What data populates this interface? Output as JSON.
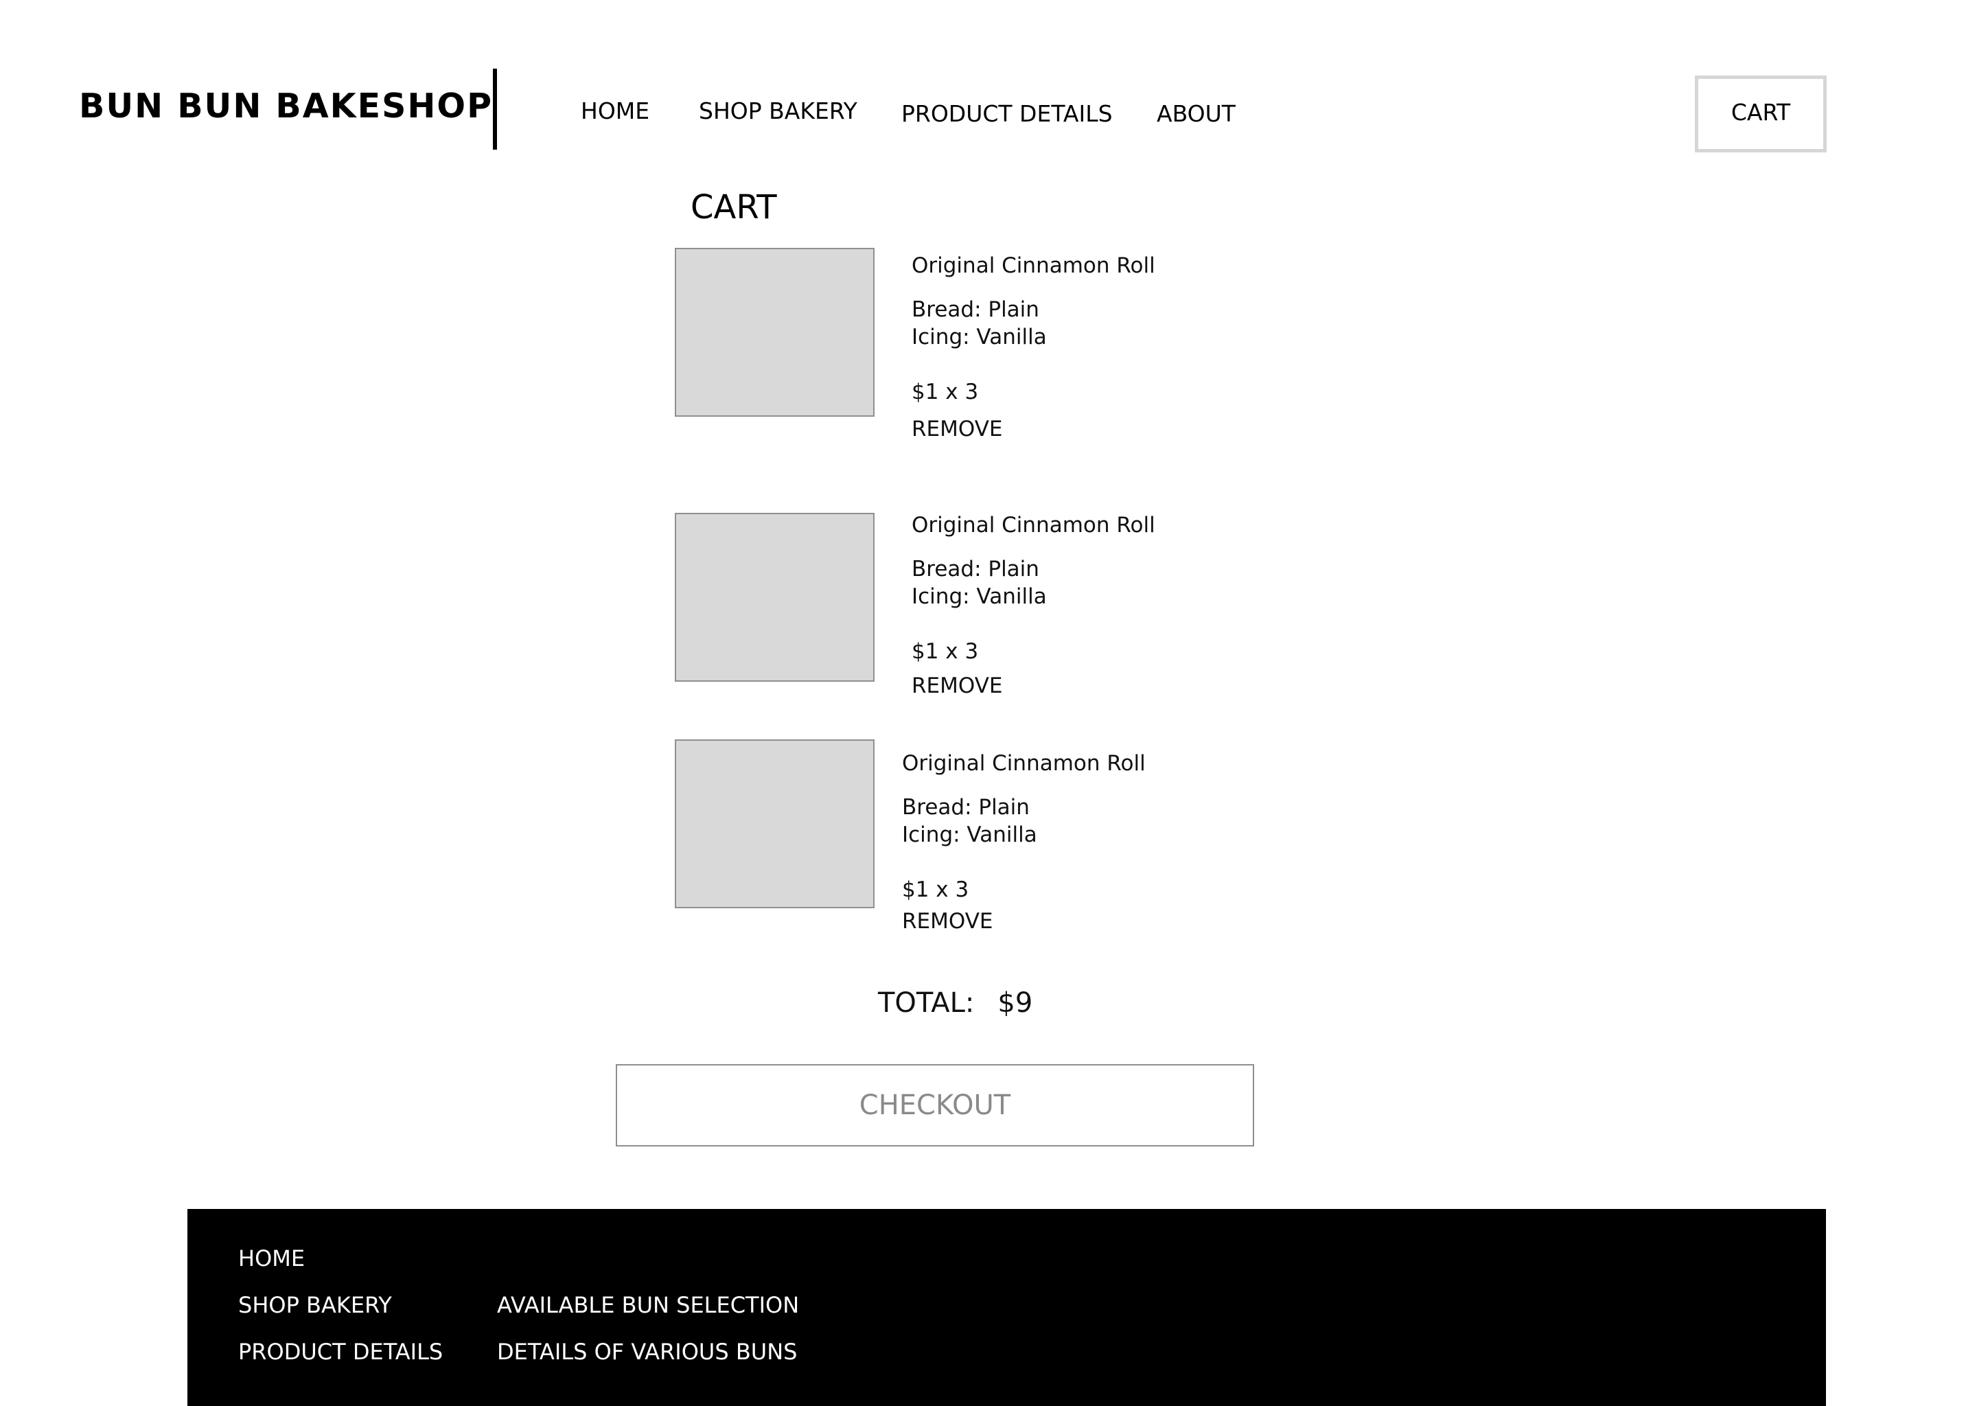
{
  "header": {
    "brand": "BUN BUN BAKESHOP",
    "nav": {
      "home": "HOME",
      "shop_bakery": "SHOP BAKERY",
      "product_details": "PRODUCT DETAILS",
      "about": "ABOUT"
    },
    "cart_button": "CART"
  },
  "cart": {
    "title": "CART",
    "items": [
      {
        "name": "Original Cinnamon Roll",
        "bread": "Bread: Plain",
        "icing": "Icing: Vanilla",
        "price_qty": "$1 x 3",
        "remove_label": "REMOVE"
      },
      {
        "name": "Original Cinnamon Roll",
        "bread": "Bread: Plain",
        "icing": "Icing: Vanilla",
        "price_qty": "$1 x 3",
        "remove_label": "REMOVE"
      },
      {
        "name": "Original Cinnamon Roll",
        "bread": "Bread: Plain",
        "icing": "Icing: Vanilla",
        "price_qty": "$1 x 3",
        "remove_label": "REMOVE"
      }
    ],
    "total_label": "TOTAL:",
    "total_value": "$9",
    "checkout_label": "CHECKOUT"
  },
  "footer": {
    "home": "HOME",
    "shop_bakery": "SHOP BAKERY",
    "product_details": "PRODUCT DETAILS",
    "available_bun_selection": "AVAILABLE BUN SELECTION",
    "details_of_various_buns": "DETAILS OF VARIOUS BUNS"
  },
  "colors": {
    "placeholder_fill": "#d9d9d9",
    "placeholder_border": "#8f8f8f",
    "cart_button_border": "#d6d6d6",
    "checkout_text": "#8a8a8a",
    "footer_background": "#000000"
  }
}
